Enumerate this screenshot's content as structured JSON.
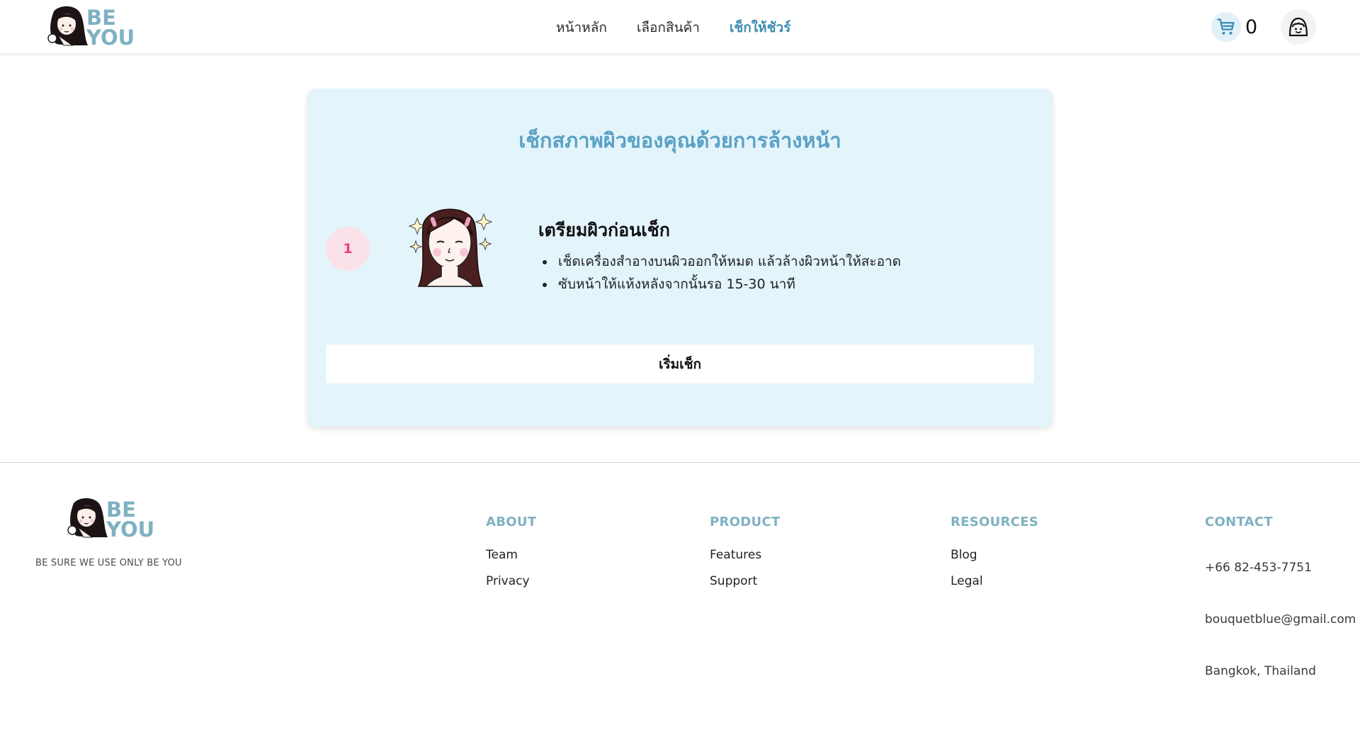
{
  "brand": {
    "logo_line1": "BE",
    "logo_line2": "YOU",
    "tagline": "BE SURE WE USE ONLY BE YOU",
    "color": "#7fb1c1"
  },
  "nav": {
    "items": [
      {
        "label": "หน้าหลัก",
        "active": false
      },
      {
        "label": "เลือกสินค้า",
        "active": false
      },
      {
        "label": "เช็กให้ชัวร์",
        "active": true
      }
    ],
    "active_color": "#3e8db5"
  },
  "cart": {
    "icon": "cart-icon",
    "count": "0"
  },
  "profile": {
    "icon": "profile-face-icon"
  },
  "card": {
    "title": "เช็กสภาพผิวของคุณด้วยการล้างหน้า",
    "step_number": "1",
    "step_title": "เตรียมผิวก่อนเช็ก",
    "bullets": [
      "เช็ดเครื่องสำอางบนผิวออกให้หมด แล้วล้างผิวหน้าให้สะอาด",
      "ซับหน้าให้แห้งหลังจากนั้นรอ 15-30 นาที"
    ],
    "button_label": "เริ่มเช็ก",
    "illustration": "face-illustration",
    "background": "#e3f4fb"
  },
  "footer": {
    "columns": [
      {
        "heading": "ABOUT",
        "links": [
          "Team",
          "Privacy"
        ]
      },
      {
        "heading": "PRODUCT",
        "links": [
          "Features",
          "Support"
        ]
      },
      {
        "heading": "RESOURCES",
        "links": [
          "Blog",
          "Legal"
        ]
      }
    ],
    "contact": {
      "heading": "CONTACT",
      "phone": "+66 82-453-7751",
      "email": "bouquetblue@gmail.com",
      "location": "Bangkok, Thailand"
    }
  }
}
